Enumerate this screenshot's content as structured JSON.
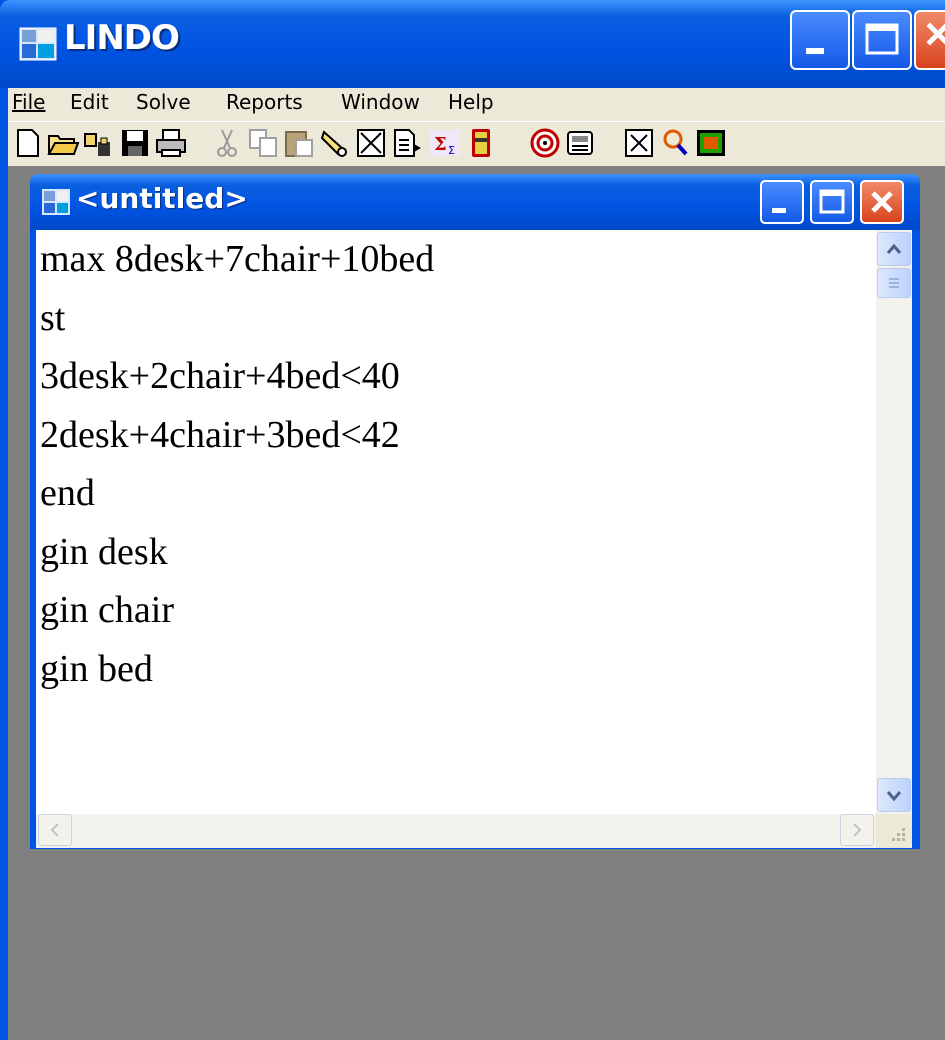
{
  "app": {
    "title": "LINDO",
    "icon": "lindo-app-icon"
  },
  "menu": {
    "items": [
      "File",
      "Edit",
      "Solve",
      "Reports",
      "Window",
      "Help"
    ]
  },
  "toolbar": {
    "icons": [
      "new-file-icon",
      "open-folder-icon",
      "view-icon",
      "save-icon",
      "print-icon",
      "cut-icon",
      "copy-icon",
      "paste-icon",
      "find-icon",
      "clear-icon",
      "go-to-line-icon",
      "solve-icon",
      "compile-icon",
      "options-icon",
      "status-icon",
      "send-to-back-icon",
      "tile-icon",
      "help-icon"
    ]
  },
  "child": {
    "title": "<untitled>"
  },
  "editor": {
    "lines": [
      "max 8desk+7chair+10bed",
      "st",
      "3desk+2chair+4bed<40",
      "2desk+4chair+3bed<42",
      "end",
      "gin desk",
      "gin chair",
      "gin bed"
    ]
  },
  "colors": {
    "titlebar_blue": "#0054e3",
    "client_gray": "#ece9d8",
    "mdi_gray": "#808080",
    "close_red": "#d9431e"
  }
}
